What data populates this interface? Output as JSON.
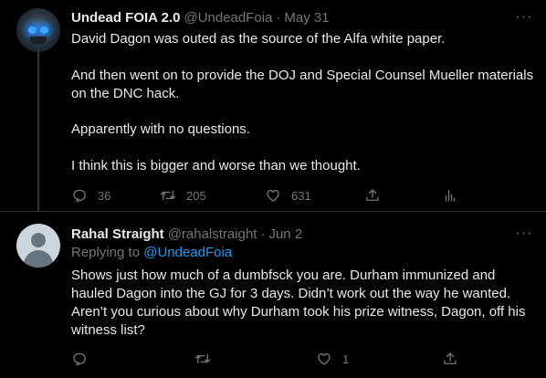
{
  "tweet1": {
    "display_name": "Undead FOIA 2.0",
    "handle": "@UndeadFoia",
    "separator": "·",
    "date": "May 31",
    "paragraphs": [
      "David Dagon was outed as the source of the Alfa white paper.",
      "And then went on to provide the DOJ and Special Counsel Mueller materials on the DNC hack.",
      "Apparently with no questions.",
      "I think this is bigger and worse than we thought."
    ],
    "actions": {
      "reply_count": "36",
      "retweet_count": "205",
      "like_count": "631"
    }
  },
  "tweet2": {
    "display_name": "Rahal Straight",
    "handle": "@rahalstraight",
    "separator": "·",
    "date": "Jun 2",
    "replying_prefix": "Replying to",
    "replying_mention": "@UndeadFoia",
    "text": "Shows just how much of a dumbfsck you are. Durham immunized and hauled Dagon into the GJ for 3 days. Didn’t work out the way he wanted. Aren’t you curious about why Durham took his prize witness, Dagon, off his witness list?",
    "actions": {
      "like_count": "1"
    }
  },
  "more_glyph": "···",
  "icons": [
    "reply-icon",
    "retweet-icon",
    "like-icon",
    "share-icon",
    "analytics-icon",
    "more-icon"
  ],
  "colors": {
    "background": "#000000",
    "text": "#e7e9ea",
    "secondary": "#71767b",
    "accent": "#1d9bf0",
    "divider": "#2f3336"
  }
}
